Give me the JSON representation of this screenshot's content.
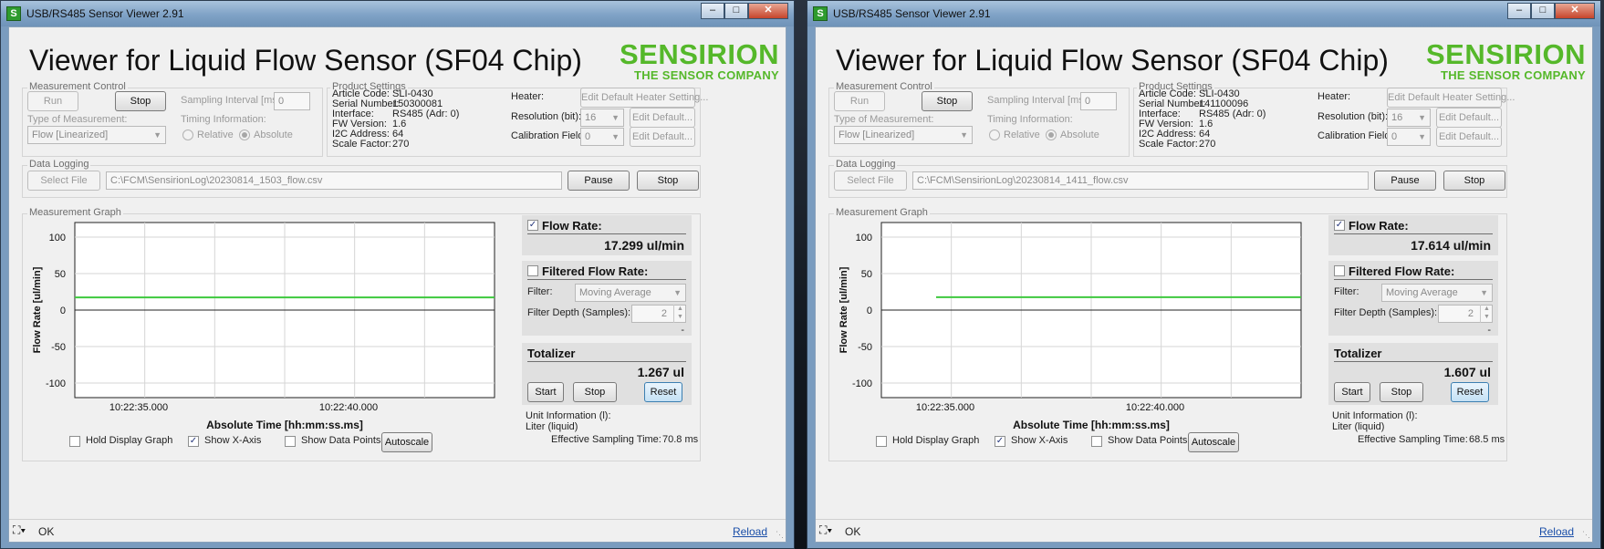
{
  "windows": [
    {
      "title": "USB/RS485 Sensor Viewer 2.91",
      "heading": "Viewer for Liquid Flow Sensor (SF04 Chip)",
      "logo": {
        "line1": "SENSIRION",
        "line2": "THE SENSOR COMPANY"
      },
      "measurement_control": {
        "label": "Measurement Control",
        "run": "Run",
        "stop": "Stop",
        "sampling_interval_label": "Sampling Interval [ms]:",
        "sampling_interval_value": "0",
        "type_label": "Type of Measurement:",
        "type_value": "Flow [Linearized]",
        "timing_label": "Timing Information:",
        "relative": "Relative",
        "absolute": "Absolute"
      },
      "product_settings": {
        "label": "Product Settings",
        "fields": [
          {
            "key": "Article Code:",
            "value": "SLI-0430"
          },
          {
            "key": "Serial Number:",
            "value": "150300081"
          },
          {
            "key": "Interface:",
            "value": "RS485 (Adr: 0)"
          },
          {
            "key": "FW Version:",
            "value": "1.6"
          },
          {
            "key": "I2C Address:",
            "value": "64"
          },
          {
            "key": "Scale Factor:",
            "value": "270"
          }
        ],
        "heater_label": "Heater:",
        "heater_button": "Edit Default Heater Setting...",
        "resolution_label": "Resolution (bit):",
        "resolution_value": "16",
        "resolution_button": "Edit Default...",
        "calibration_label": "Calibration Field:",
        "calibration_value": "0",
        "calibration_button": "Edit Default..."
      },
      "data_logging": {
        "label": "Data Logging",
        "select_file": "Select File",
        "path": "C:\\FCM\\SensirionLog\\20230814_1503_flow.csv",
        "pause": "Pause",
        "stop": "Stop"
      },
      "graph": {
        "label": "Measurement Graph",
        "ylabel": "Flow Rate [ul/min]",
        "xlabel": "Absolute Time [hh:mm:ss.ms]",
        "yticks": [
          "100",
          "50",
          "0",
          "-50",
          "-100"
        ],
        "xticks": [
          "10:22:35.000",
          "10:22:40.000"
        ],
        "line_color": "#3ec93e",
        "flow_value": 17.299
      },
      "flow_panel": {
        "title": "Flow Rate:",
        "value": "17.299 ul/min",
        "checked": true
      },
      "filtered_panel": {
        "title": "Filtered Flow Rate:",
        "filter_label": "Filter:",
        "filter_value": "Moving Average",
        "depth_label": "Filter Depth (Samples):",
        "depth_value": "2",
        "dash": "-"
      },
      "totalizer": {
        "title": "Totalizer",
        "value": "1.267 ul",
        "start": "Start",
        "stop": "Stop",
        "reset": "Reset"
      },
      "unit_info": {
        "line1": "Unit Information (l):",
        "line2": "Liter (liquid)"
      },
      "sampling": {
        "label": "Effective Sampling Time:",
        "value": "70.8 ms"
      },
      "options": {
        "hold": "Hold Display Graph",
        "show_x": "Show X-Axis",
        "show_points": "Show Data Points",
        "autoscale": "Autoscale"
      },
      "status": {
        "text": "OK",
        "reload": "Reload"
      }
    },
    {
      "title": "USB/RS485 Sensor Viewer 2.91",
      "heading": "Viewer for Liquid Flow Sensor (SF04 Chip)",
      "logo": {
        "line1": "SENSIRION",
        "line2": "THE SENSOR COMPANY"
      },
      "measurement_control": {
        "label": "Measurement Control",
        "run": "Run",
        "stop": "Stop",
        "sampling_interval_label": "Sampling Interval [ms]:",
        "sampling_interval_value": "0",
        "type_label": "Type of Measurement:",
        "type_value": "Flow [Linearized]",
        "timing_label": "Timing Information:",
        "relative": "Relative",
        "absolute": "Absolute"
      },
      "product_settings": {
        "label": "Product Settings",
        "fields": [
          {
            "key": "Article Code:",
            "value": "SLI-0430"
          },
          {
            "key": "Serial Number:",
            "value": "141100096"
          },
          {
            "key": "Interface:",
            "value": "RS485 (Adr: 0)"
          },
          {
            "key": "FW Version:",
            "value": "1.6"
          },
          {
            "key": "I2C Address:",
            "value": "64"
          },
          {
            "key": "Scale Factor:",
            "value": "270"
          }
        ],
        "heater_label": "Heater:",
        "heater_button": "Edit Default Heater Setting...",
        "resolution_label": "Resolution (bit):",
        "resolution_value": "16",
        "resolution_button": "Edit Default...",
        "calibration_label": "Calibration Field:",
        "calibration_value": "0",
        "calibration_button": "Edit Default..."
      },
      "data_logging": {
        "label": "Data Logging",
        "select_file": "Select File",
        "path": "C:\\FCM\\SensirionLog\\20230814_1411_flow.csv",
        "pause": "Pause",
        "stop": "Stop"
      },
      "graph": {
        "label": "Measurement Graph",
        "ylabel": "Flow Rate [ul/min]",
        "xlabel": "Absolute Time [hh:mm:ss.ms]",
        "yticks": [
          "100",
          "50",
          "0",
          "-50",
          "-100"
        ],
        "xticks": [
          "10:22:35.000",
          "10:22:40.000"
        ],
        "line_color": "#3ec93e",
        "flow_value": 17.614
      },
      "flow_panel": {
        "title": "Flow Rate:",
        "value": "17.614 ul/min",
        "checked": true
      },
      "filtered_panel": {
        "title": "Filtered Flow Rate:",
        "filter_label": "Filter:",
        "filter_value": "Moving Average",
        "depth_label": "Filter Depth (Samples):",
        "depth_value": "2",
        "dash": "-"
      },
      "totalizer": {
        "title": "Totalizer",
        "value": "1.607 ul",
        "start": "Start",
        "stop": "Stop",
        "reset": "Reset"
      },
      "unit_info": {
        "line1": "Unit Information (l):",
        "line2": "Liter (liquid)"
      },
      "sampling": {
        "label": "Effective Sampling Time:",
        "value": "68.5 ms"
      },
      "options": {
        "hold": "Hold Display Graph",
        "show_x": "Show X-Axis",
        "show_points": "Show Data Points",
        "autoscale": "Autoscale"
      },
      "status": {
        "text": "OK",
        "reload": "Reload"
      }
    }
  ]
}
